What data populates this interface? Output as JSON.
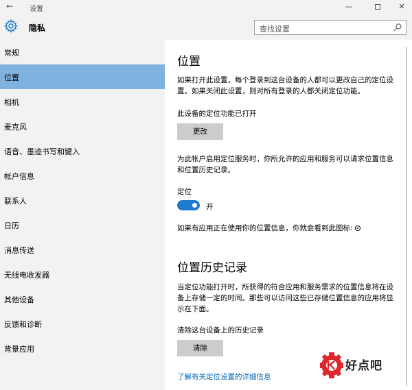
{
  "window": {
    "title": "设置",
    "back_glyph": "←",
    "minimize_glyph": "—",
    "close_glyph": "✕"
  },
  "header": {
    "title": "隐私",
    "icon": "gear-icon"
  },
  "search": {
    "placeholder": "查找设置",
    "icon": "search-icon"
  },
  "sidebar": {
    "selected_color": "#7fb2de",
    "items": [
      {
        "label": "常规"
      },
      {
        "label": "位置"
      },
      {
        "label": "相机"
      },
      {
        "label": "麦克风"
      },
      {
        "label": "语音、墨迹书写和键入"
      },
      {
        "label": "帐户信息"
      },
      {
        "label": "联系人"
      },
      {
        "label": "日历"
      },
      {
        "label": "消息传送"
      },
      {
        "label": "无线电收发器"
      },
      {
        "label": "其他设备"
      },
      {
        "label": "反馈和诊断"
      },
      {
        "label": "背景应用"
      }
    ]
  },
  "main": {
    "title": "位置",
    "intro": "如果打开此设置，每个登录到这台设备的人都可以更改自己的定位设置。如果关闭此设置，则对所有登录的人都关闭定位功能。",
    "device_status": "此设备的定位功能已打开",
    "change_button": "更改",
    "service_desc": "为此帐户启用定位服务时，你所允许的应用和服务可以请求位置信息和位置历史记录。",
    "location_label": "定位",
    "toggle_state": "开",
    "accent_color": "#1e7acb",
    "icon_note": "如果有应用正在使用你的位置信息，你就会看到此图标:",
    "icon_note_icon": "location-in-use-icon",
    "history_title": "位置历史记录",
    "history_desc": "当定位功能打开时，所获得的符合应用和服务需求的位置信息将在设备上存储一定的时间。那些可以访问这些已存储位置信息的应用将显示在下面。",
    "clear_label": "清除这台设备上的历史记录",
    "clear_button": "清除",
    "learn_more_link": "了解有关定位设置的详细信息"
  },
  "watermark": {
    "text": "好点吧",
    "color": "#e0272c"
  }
}
